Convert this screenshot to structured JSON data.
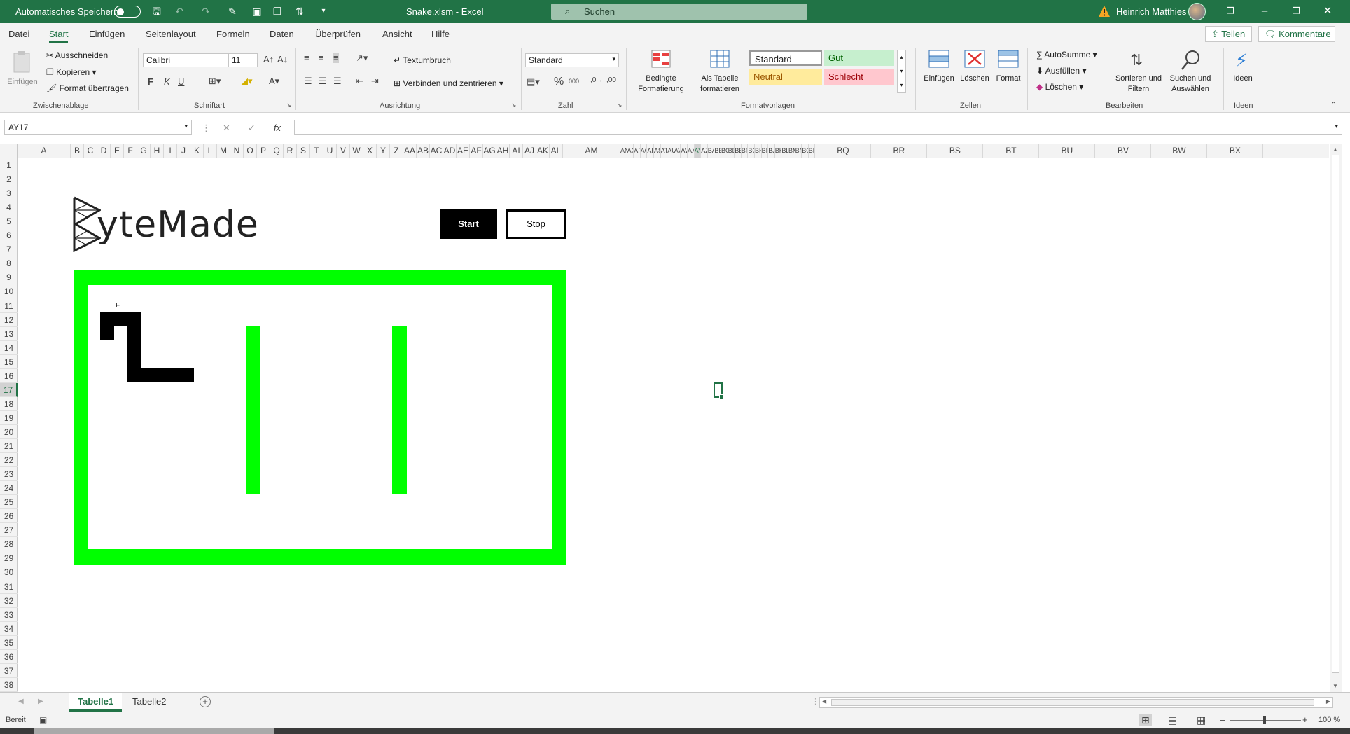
{
  "titlebar": {
    "autosave_label": "Automatisches Speichern",
    "filename": "Snake.xlsm  -  Excel",
    "search_placeholder": "Suchen",
    "user_name": "Heinrich Matthies"
  },
  "menu": {
    "tabs": [
      "Datei",
      "Start",
      "Einfügen",
      "Seitenlayout",
      "Formeln",
      "Daten",
      "Überprüfen",
      "Ansicht",
      "Hilfe"
    ],
    "active_tab": "Start",
    "share_label": "Teilen",
    "comments_label": "Kommentare"
  },
  "ribbon": {
    "clipboard": {
      "paste": "Einfügen",
      "cut": "Ausschneiden",
      "copy": "Kopieren",
      "format_painter": "Format übertragen",
      "label": "Zwischenablage"
    },
    "font": {
      "name": "Calibri",
      "size": "11",
      "bold": "F",
      "italic": "K",
      "underline": "U",
      "label": "Schriftart"
    },
    "alignment": {
      "wrap": "Textumbruch",
      "merge": "Verbinden und zentrieren",
      "label": "Ausrichtung"
    },
    "number": {
      "format": "Standard",
      "label": "Zahl"
    },
    "styles": {
      "conditional_1": "Bedingte",
      "conditional_2": "Formatierung",
      "as_table_1": "Als Tabelle",
      "as_table_2": "formatieren",
      "standard": "Standard",
      "gut": "Gut",
      "neutral": "Neutral",
      "schlecht": "Schlecht",
      "label": "Formatvorlagen"
    },
    "cells": {
      "insert": "Einfügen",
      "delete": "Löschen",
      "format": "Format",
      "label": "Zellen"
    },
    "editing": {
      "autosum": "AutoSumme",
      "fill": "Ausfüllen",
      "clear": "Löschen",
      "sort_1": "Sortieren und",
      "sort_2": "Filtern",
      "find_1": "Suchen und",
      "find_2": "Auswählen",
      "label": "Bearbeiten"
    },
    "ideas": {
      "label_btn": "Ideen",
      "label": "Ideen"
    }
  },
  "formula": {
    "name_box": "AY17",
    "fx": "fx",
    "value": ""
  },
  "grid": {
    "columns": [
      "A",
      "B",
      "C",
      "D",
      "E",
      "F",
      "G",
      "H",
      "I",
      "J",
      "K",
      "L",
      "M",
      "N",
      "O",
      "P",
      "Q",
      "R",
      "S",
      "T",
      "U",
      "V",
      "W",
      "X",
      "Y",
      "Z",
      "AA",
      "AB",
      "AC",
      "AD",
      "AE",
      "AF",
      "AG",
      "AH",
      "AI",
      "AJ",
      "AK",
      "AL",
      "AM",
      "AN",
      "AO",
      "AP",
      "AQ",
      "AR",
      "AS",
      "AT",
      "AU",
      "AV",
      "AW",
      "AX",
      "AY",
      "AZ",
      "BA",
      "BB",
      "BC",
      "BD",
      "BE",
      "BF",
      "BG",
      "BH",
      "BI",
      "BJ",
      "BK",
      "BL",
      "BM",
      "BN",
      "BO",
      "BP",
      "BQ",
      "BR",
      "BS",
      "BT",
      "BU",
      "BV",
      "BW",
      "BX"
    ],
    "rows": [
      "1",
      "2",
      "3",
      "4",
      "5",
      "6",
      "7",
      "8",
      "9",
      "10",
      "11",
      "12",
      "13",
      "14",
      "15",
      "16",
      "17",
      "18",
      "19",
      "20",
      "21",
      "22",
      "23",
      "24",
      "25",
      "26",
      "27",
      "28",
      "29",
      "30",
      "31",
      "32",
      "33",
      "34",
      "35",
      "36",
      "37",
      "38"
    ],
    "selected_row": "17",
    "selected_col": "AY"
  },
  "game": {
    "logo_text": "yteMade",
    "start_label": "Start",
    "stop_label": "Stop",
    "food_marker": "F",
    "board_color": "#00ff00",
    "snake_color": "#000000"
  },
  "sheets": {
    "tabs": [
      "Tabelle1",
      "Tabelle2"
    ],
    "active": "Tabelle1"
  },
  "status": {
    "ready": "Bereit",
    "zoom": "100 %"
  },
  "colors": {
    "accent": "#217346"
  }
}
